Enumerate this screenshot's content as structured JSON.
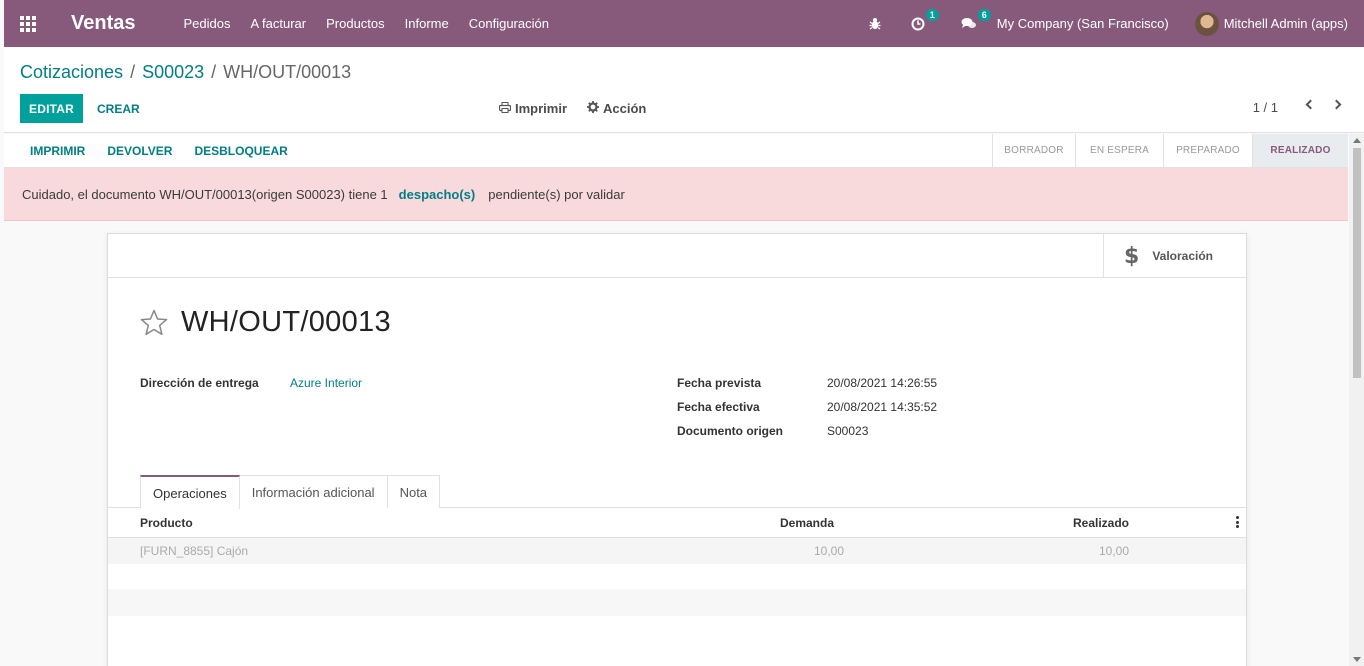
{
  "navbar": {
    "app_name": "Ventas",
    "menu": [
      "Pedidos",
      "A facturar",
      "Productos",
      "Informe",
      "Configuración"
    ],
    "activity_count": "1",
    "messages_count": "6",
    "company": "My Company (San Francisco)",
    "user": "Mitchell Admin (apps)",
    "color": "#875a7b"
  },
  "breadcrumb": {
    "items": [
      "Cotizaciones",
      "S00023"
    ],
    "current": "WH/OUT/00013"
  },
  "control": {
    "edit_label": "EDITAR",
    "create_label": "CREAR",
    "print_label": "Imprimir",
    "action_label": "Acción",
    "pager": "1 / 1"
  },
  "statusbar": {
    "buttons": [
      "IMPRIMIR",
      "DEVOLVER",
      "DESBLOQUEAR"
    ],
    "states": [
      "BORRADOR",
      "EN ESPERA",
      "PREPARADO",
      "REALIZADO"
    ],
    "active_state": "REALIZADO"
  },
  "alert": {
    "text_before": "Cuidado, el documento WH/OUT/00013(origen S00023) tiene 1",
    "link": "despacho(s)",
    "text_after": "pendiente(s) por validar"
  },
  "smart_button": {
    "icon": "dollar-icon",
    "label": "Valoración"
  },
  "record": {
    "title": "WH/OUT/00013",
    "delivery_label": "Dirección de entrega",
    "delivery_value": "Azure Interior",
    "scheduled_label": "Fecha prevista",
    "scheduled_value": "20/08/2021 14:26:55",
    "effective_label": "Fecha efectiva",
    "effective_value": "20/08/2021 14:35:52",
    "origin_label": "Documento origen",
    "origin_value": "S00023"
  },
  "tabs": [
    "Operaciones",
    "Información adicional",
    "Nota"
  ],
  "table": {
    "headers": [
      "Producto",
      "Demanda",
      "Realizado"
    ],
    "rows": [
      {
        "product": "[FURN_8855] Cajón",
        "demand": "10,00",
        "done": "10,00"
      }
    ]
  },
  "colors": {
    "primary": "#00a09d",
    "link": "#017e84",
    "alert_bg": "#f8dadd"
  }
}
